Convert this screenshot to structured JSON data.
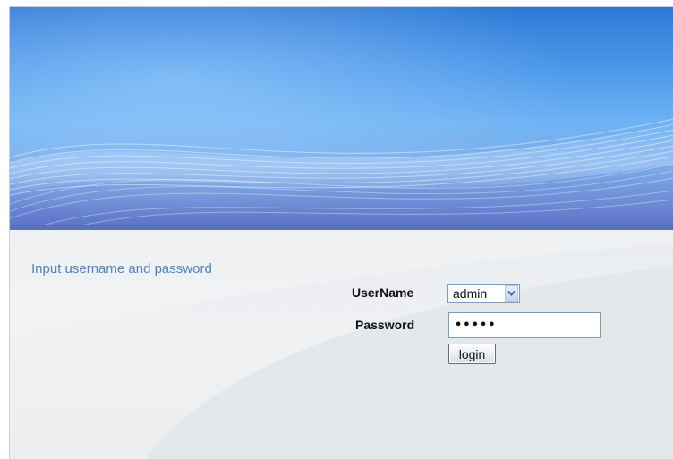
{
  "login": {
    "prompt_title": "Input username and password",
    "username_label": "UserName",
    "username_value": "admin",
    "password_label": "Password",
    "password_value": "•••••",
    "login_button": "login"
  },
  "icons": {
    "select_arrow": "chevron-down-icon"
  },
  "colors": {
    "banner_top": "#2f79d6",
    "banner_mid": "#6fb3f4",
    "banner_bottom": "#5a71c5",
    "prompt_title": "#4f83bb",
    "panel_background": "#eef0f2",
    "input_border": "#7f9db9"
  }
}
